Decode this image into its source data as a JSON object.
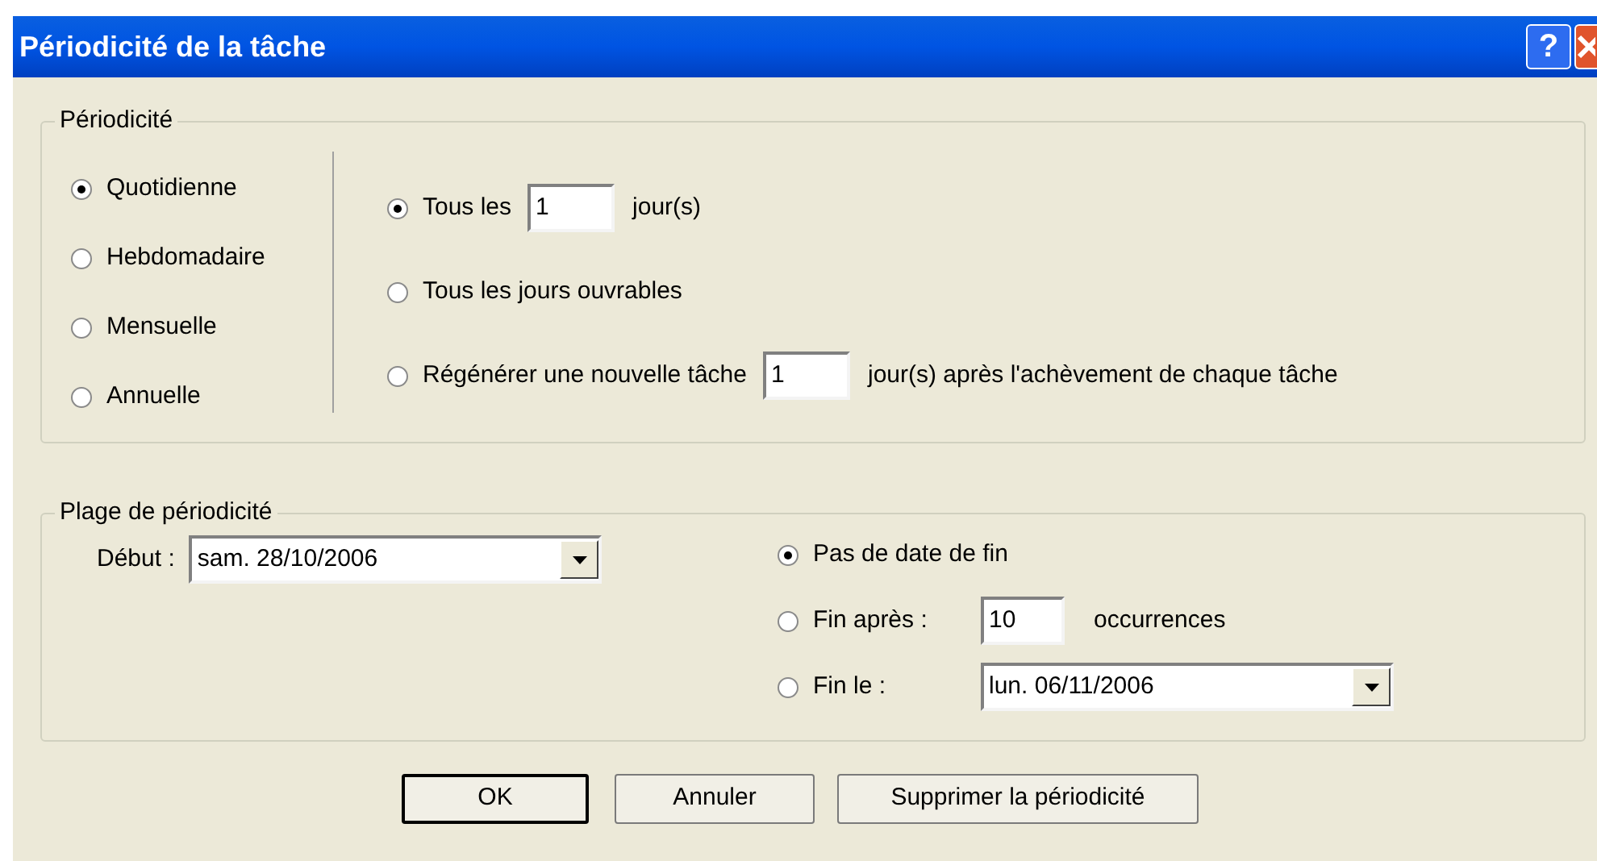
{
  "window": {
    "title": "Périodicité de la tâche",
    "help": "?"
  },
  "recurrence": {
    "legend": "Périodicité",
    "patterns": [
      {
        "label": "Quotidienne",
        "selected": true
      },
      {
        "label": "Hebdomadaire",
        "selected": false
      },
      {
        "label": "Mensuelle",
        "selected": false
      },
      {
        "label": "Annuelle",
        "selected": false
      }
    ],
    "options": [
      {
        "kind": "every",
        "label": "Tous les",
        "value": "1",
        "unit": "jour(s)",
        "selected": true
      },
      {
        "kind": "plain",
        "label": "Tous les jours ouvrables",
        "selected": false
      },
      {
        "kind": "regenerate",
        "label": "Régénérer une nouvelle tâche",
        "value": "1",
        "unit": "jour(s) après l'achèvement de chaque tâche",
        "selected": false
      }
    ]
  },
  "range": {
    "legend": "Plage de périodicité",
    "start": {
      "label": "Début :",
      "value": "sam. 28/10/2006"
    },
    "end_options": [
      {
        "kind": "plain",
        "label": "Pas de date de fin",
        "selected": true
      },
      {
        "kind": "count",
        "label": "Fin après :",
        "value": "10",
        "unit": "occurrences",
        "selected": false
      },
      {
        "kind": "date",
        "label": "Fin le :",
        "value": "lun. 06/11/2006",
        "selected": false
      }
    ]
  },
  "buttons": [
    {
      "label": "OK",
      "default": true
    },
    {
      "label": "Annuler",
      "default": false
    },
    {
      "label": "Supprimer la périodicité",
      "default": false
    }
  ]
}
